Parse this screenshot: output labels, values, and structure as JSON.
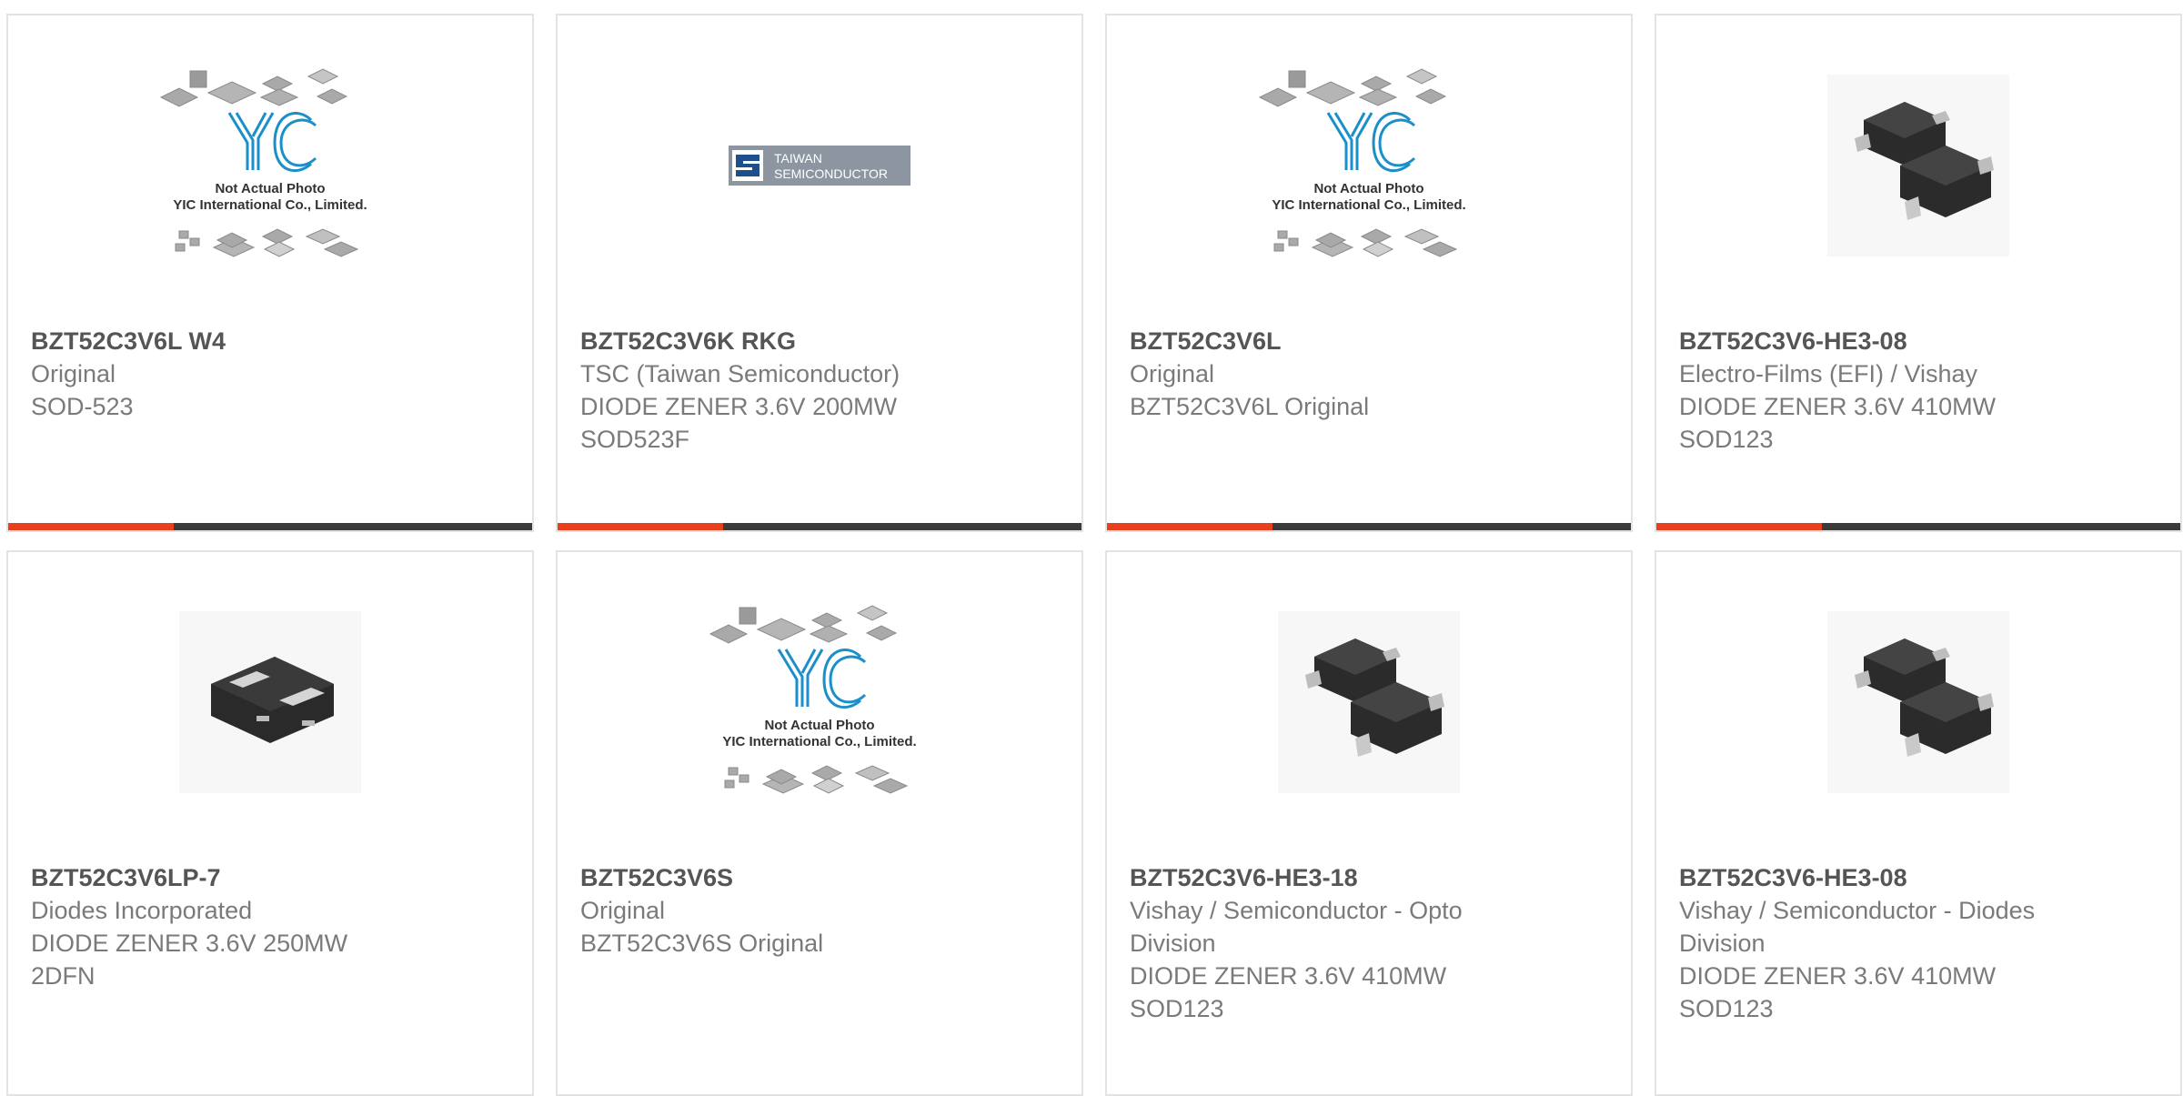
{
  "colors": {
    "accent": "#e8401c",
    "bar_dark": "#3a3a3a",
    "yic_blue": "#1a8fc9",
    "tsc_blue": "#1d4f8c",
    "tsc_gray": "#8d96a0"
  },
  "placeholder_image": {
    "line1": "Not Actual Photo",
    "line2": "YIC International Co., Limited."
  },
  "tsc_logo": {
    "line1": "TAIWAN",
    "line2": "SEMICONDUCTOR"
  },
  "products": [
    {
      "part_number": "BZT52C3V6L W4",
      "lines": [
        "Original",
        "SOD-523"
      ],
      "image": "yic-placeholder"
    },
    {
      "part_number": "BZT52C3V6K RKG",
      "lines": [
        "TSC (Taiwan Semiconductor)",
        "DIODE ZENER 3.6V 200MW",
        "SOD523F"
      ],
      "image": "tsc-logo"
    },
    {
      "part_number": "BZT52C3V6L",
      "lines": [
        "Original",
        "BZT52C3V6L Original"
      ],
      "image": "yic-placeholder"
    },
    {
      "part_number": "BZT52C3V6-HE3-08",
      "lines": [
        "Electro-Films (EFI) / Vishay",
        "DIODE ZENER 3.6V 410MW",
        "SOD123"
      ],
      "image": "sod123-package"
    },
    {
      "part_number": "BZT52C3V6LP-7",
      "lines": [
        "Diodes Incorporated",
        "DIODE ZENER 3.6V 250MW",
        "2DFN"
      ],
      "image": "dfn-package"
    },
    {
      "part_number": "BZT52C3V6S",
      "lines": [
        "Original",
        "BZT52C3V6S Original"
      ],
      "image": "yic-placeholder"
    },
    {
      "part_number": "BZT52C3V6-HE3-18",
      "lines": [
        "Vishay / Semiconductor - Opto",
        "Division",
        "DIODE ZENER 3.6V 410MW",
        "SOD123"
      ],
      "image": "sod123-package"
    },
    {
      "part_number": "BZT52C3V6-HE3-08",
      "lines": [
        "Vishay / Semiconductor - Diodes",
        "Division",
        "DIODE ZENER 3.6V 410MW",
        "SOD123"
      ],
      "image": "sod123-package"
    }
  ]
}
